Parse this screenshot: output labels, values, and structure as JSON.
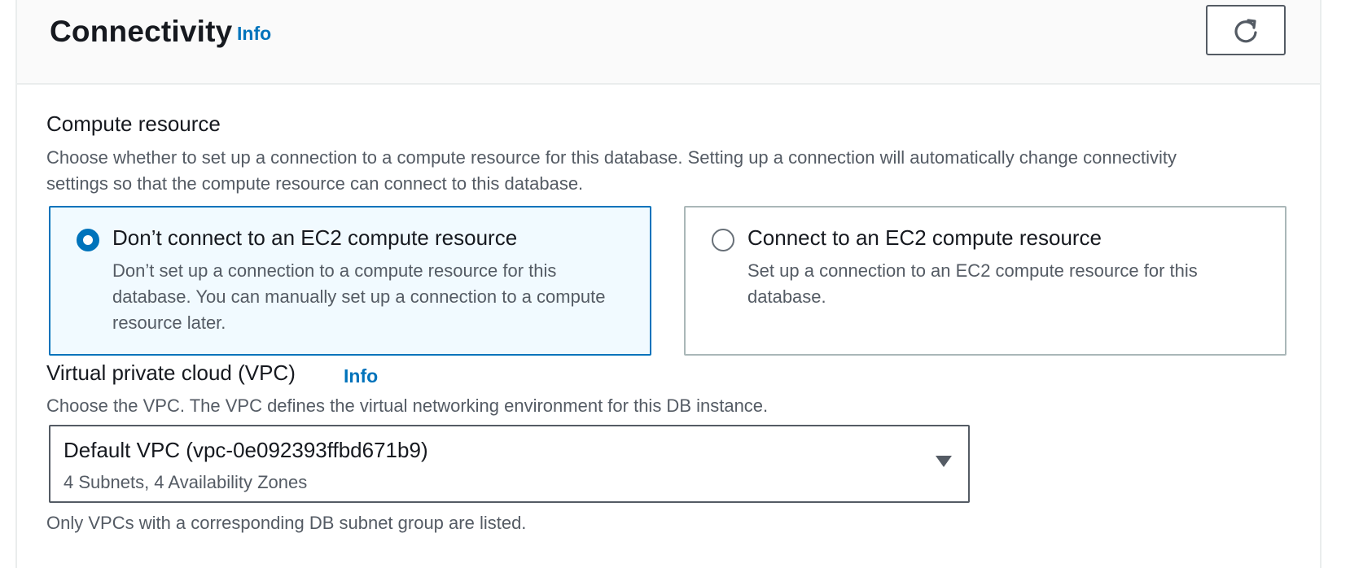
{
  "header": {
    "title": "Connectivity",
    "info_label": "Info",
    "refresh_icon": "refresh-icon"
  },
  "compute": {
    "label": "Compute resource",
    "description": "Choose whether to set up a connection to a compute resource for this database. Setting up a connection will automatically change connectivity settings so that the compute resource can connect to this database.",
    "options": [
      {
        "title": "Don’t connect to an EC2 compute resource",
        "description": "Don’t set up a connection to a compute resource for this database. You can manually set up a connection to a compute resource later.",
        "selected": true
      },
      {
        "title": "Connect to an EC2 compute resource",
        "description": "Set up a connection to an EC2 compute resource for this database.",
        "selected": false
      }
    ]
  },
  "vpc": {
    "label": "Virtual private cloud (VPC)",
    "info_label": "Info",
    "description": "Choose the VPC. The VPC defines the virtual networking environment for this DB instance.",
    "selected_value": "Default VPC (vpc-0e092393ffbd671b9)",
    "selected_detail": "4 Subnets, 4 Availability Zones",
    "caret_icon": "caret-down-icon",
    "hint": "Only VPCs with a corresponding DB subnet group are listed."
  },
  "colors": {
    "accent": "#0073bb",
    "selected_tile_bg": "#f1faff",
    "border": "#aab7b8",
    "text": "#16191f",
    "muted": "#545b64"
  }
}
